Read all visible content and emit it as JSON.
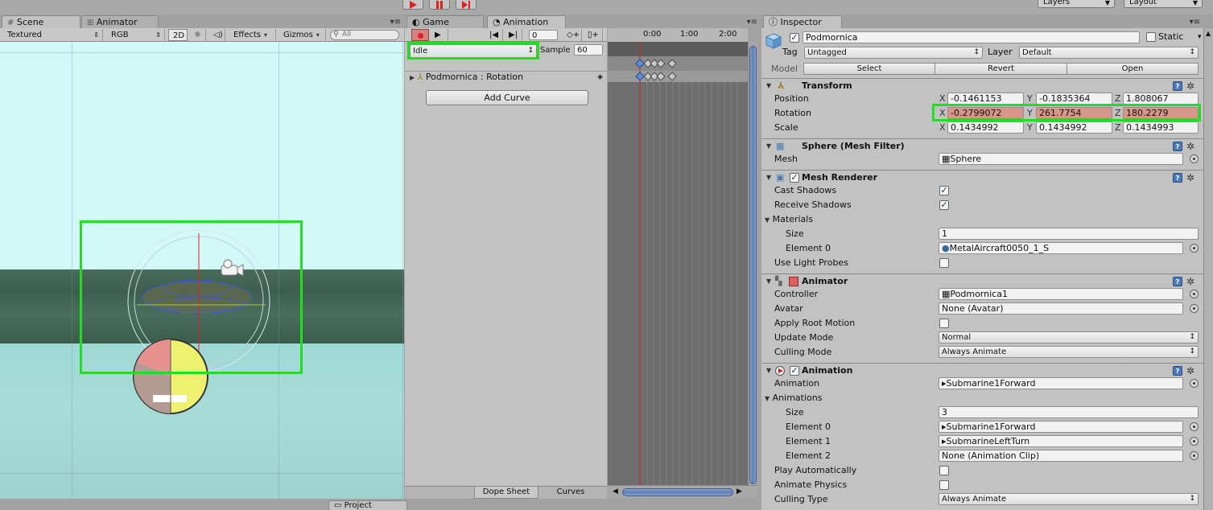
{
  "toolbar": {
    "layers_label": "Layers",
    "layout_label": "Layout"
  },
  "scene_panel": {
    "tabs": [
      {
        "label": "Scene"
      },
      {
        "label": "Animator"
      }
    ],
    "draw_mode": "Textured",
    "render_mode": "RGB",
    "mode_2d": "2D",
    "effects_label": "Effects",
    "gizmos_label": "Gizmos",
    "search_placeholder": "All"
  },
  "animation_panel": {
    "tabs": [
      {
        "label": "Game"
      },
      {
        "label": "Animation"
      }
    ],
    "frame_value": "0",
    "clip_name": "Idle",
    "sample_label": "Sample",
    "sample_value": "60",
    "timeline_labels": [
      "0:00",
      "1:00",
      "2:00"
    ],
    "curve_property": "Podmornica : Rotation",
    "add_curve_label": "Add Curve",
    "bottom_tabs": [
      "Dope Sheet",
      "Curves"
    ]
  },
  "bottom_panel": {
    "project_tab": "Project"
  },
  "inspector": {
    "tab_label": "Inspector",
    "object_name": "Podmornica",
    "static_label": "Static",
    "tag_label": "Tag",
    "tag_value": "Untagged",
    "layer_label": "Layer",
    "layer_value": "Default",
    "model_label": "Model",
    "model_buttons": [
      "Select",
      "Revert",
      "Open"
    ],
    "transform": {
      "title": "Transform",
      "position_label": "Position",
      "rotation_label": "Rotation",
      "scale_label": "Scale",
      "position": {
        "x": "-0.1461153",
        "y": "-0.1835364",
        "z": "1.808067"
      },
      "rotation": {
        "x": "-0.2799072",
        "y": "261.7754",
        "z": "180.2279"
      },
      "scale": {
        "x": "0.1434992",
        "y": "0.1434992",
        "z": "0.1434993"
      }
    },
    "mesh_filter": {
      "title": "Sphere (Mesh Filter)",
      "mesh_label": "Mesh",
      "mesh_value": "Sphere"
    },
    "mesh_renderer": {
      "title": "Mesh Renderer",
      "cast_shadows_label": "Cast Shadows",
      "receive_shadows_label": "Receive Shadows",
      "materials_label": "Materials",
      "size_label": "Size",
      "size_value": "1",
      "element0_label": "Element 0",
      "element0_value": "MetalAircraft0050_1_S",
      "light_probes_label": "Use Light Probes"
    },
    "animator": {
      "title": "Animator",
      "controller_label": "Controller",
      "controller_value": "Podmornica1",
      "avatar_label": "Avatar",
      "avatar_value": "None (Avatar)",
      "root_motion_label": "Apply Root Motion",
      "update_mode_label": "Update Mode",
      "update_mode_value": "Normal",
      "culling_mode_label": "Culling Mode",
      "culling_mode_value": "Always Animate"
    },
    "animation": {
      "title": "Animation",
      "animation_label": "Animation",
      "animation_value": "Submarine1Forward",
      "animations_label": "Animations",
      "size_label": "Size",
      "size_value": "3",
      "element0_label": "Element 0",
      "element0_value": "Submarine1Forward",
      "element1_label": "Element 1",
      "element1_value": "SubmarineLeftTurn",
      "element2_label": "Element 2",
      "element2_value": "None (Animation Clip)",
      "play_auto_label": "Play Automatically",
      "animate_physics_label": "Animate Physics",
      "culling_type_label": "Culling Type",
      "culling_type_value": "Always Animate"
    }
  },
  "colors": {
    "highlight_box": "#22dd22",
    "record_red": "#e02020",
    "animated_field": "#d7968a",
    "timeline_cursor": "#cc2222"
  }
}
